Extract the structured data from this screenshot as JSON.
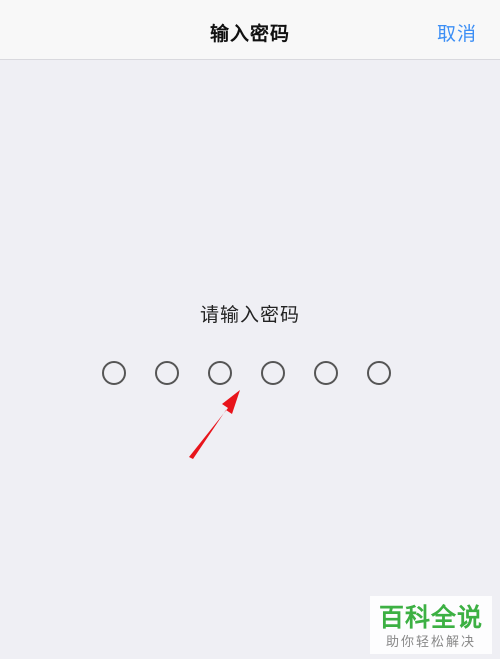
{
  "nav": {
    "title": "输入密码",
    "cancel_label": "取消"
  },
  "prompt": "请输入密码",
  "passcode": {
    "length": 6,
    "filled": 0
  },
  "annotation": {
    "icon": "red-arrow-icon",
    "color": "#e8141b"
  },
  "watermark": {
    "main": "百科全说",
    "sub": "助你轻松解决",
    "color": "#3cb043"
  },
  "colors": {
    "accent": "#3d8ff5",
    "background": "#efeff4"
  }
}
